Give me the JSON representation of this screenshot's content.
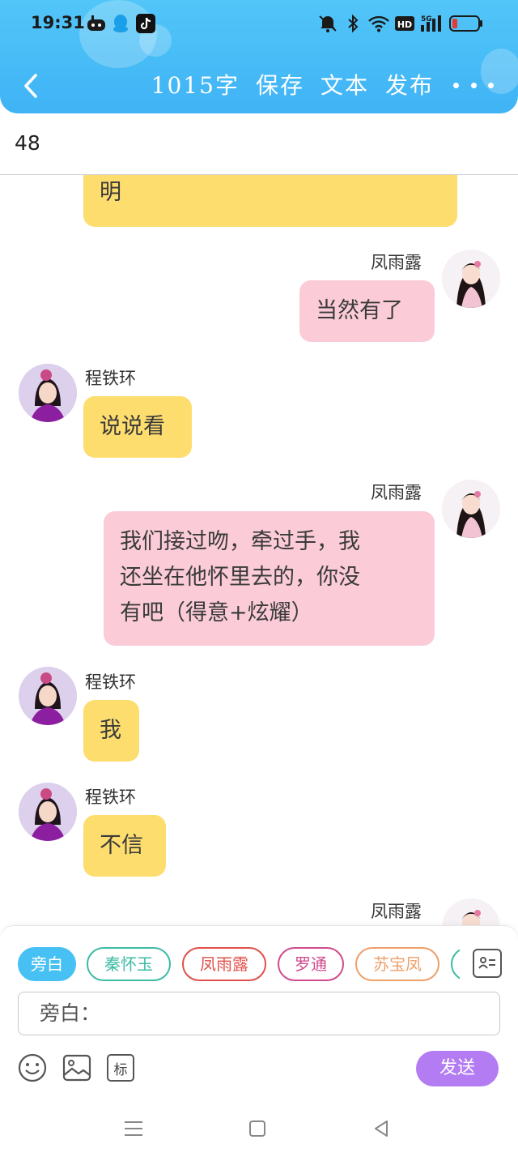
{
  "status_bar": {
    "time": "19:31",
    "left_icons": [
      "game-controller-icon",
      "qq-icon",
      "tiktok-icon"
    ],
    "right_icons": [
      "mute-icon",
      "bluetooth-icon",
      "wifi-icon",
      "hd-icon",
      "signal-5g-icon",
      "battery-icon"
    ],
    "hd_label": "HD",
    "net_label": "5G"
  },
  "toolbar": {
    "word_count": "1015字",
    "save_label": "保存",
    "text_label": "文本",
    "publish_label": "发布"
  },
  "chapter": {
    "number": "48"
  },
  "messages": [
    {
      "side": "left",
      "color": "yellow",
      "name": "",
      "text": "明"
    },
    {
      "side": "right",
      "color": "pink",
      "name": "凤雨露",
      "text": "当然有了"
    },
    {
      "side": "left",
      "color": "yellow",
      "name": "程铁环",
      "text": "说说看"
    },
    {
      "side": "right",
      "color": "pink",
      "name": "凤雨露",
      "text": "我们接过吻，牵过手，我\n还坐在他怀里去的，你没\n有吧（得意+炫耀）"
    },
    {
      "side": "left",
      "color": "yellow",
      "name": "程铁环",
      "text": "我"
    },
    {
      "side": "left",
      "color": "yellow",
      "name": "程铁环",
      "text": "不信"
    },
    {
      "side": "right",
      "color": "pink",
      "name": "凤雨露",
      "text": ""
    }
  ],
  "roles": [
    {
      "label": "旁白",
      "color": "#47c0f4",
      "active": true
    },
    {
      "label": "秦怀玉",
      "color": "#3cbca3",
      "active": false
    },
    {
      "label": "凤雨露",
      "color": "#e0504a",
      "active": false
    },
    {
      "label": "罗通",
      "color": "#d04a8e",
      "active": false
    },
    {
      "label": "苏宝凤",
      "color": "#ee9f6a",
      "active": false
    }
  ],
  "composer": {
    "input_value": "旁白：",
    "mark_label": "标",
    "send_label": "发送"
  },
  "colors": {
    "header": "#47bcf6",
    "bubble_left": "#fedd6f",
    "bubble_right": "#fbccd8",
    "send": "#b47cf2"
  }
}
